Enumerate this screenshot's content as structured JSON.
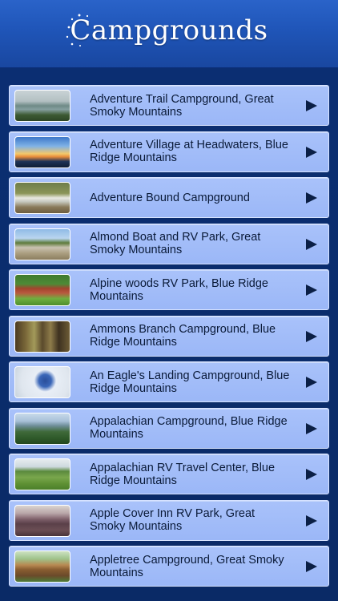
{
  "header": {
    "title": "Campgrounds"
  },
  "list": [
    {
      "name": "Adventure Trail Campground, Great Smoky Mountains",
      "thumb_icon": "lake-mountain-photo"
    },
    {
      "name": "Adventure Village at Headwaters, Blue Ridge Mountains",
      "thumb_icon": "sunset-ridge-photo"
    },
    {
      "name": "Adventure Bound Campground",
      "thumb_icon": "campsite-trailer-photo"
    },
    {
      "name": "Almond Boat and RV Park, Great Smoky Mountains",
      "thumb_icon": "rv-park-photo"
    },
    {
      "name": "Alpine woods RV Park, Blue Ridge Mountains",
      "thumb_icon": "cabin-garden-photo"
    },
    {
      "name": "Ammons Branch Campground, Blue Ridge Mountains",
      "thumb_icon": "forest-campsite-photo"
    },
    {
      "name": "An Eagle's Landing Campground, Blue Ridge Mountains",
      "thumb_icon": "zipline-photo"
    },
    {
      "name": "Appalachian Campground, Blue Ridge Mountains",
      "thumb_icon": "mountain-valley-photo"
    },
    {
      "name": "Appalachian RV Travel Center, Blue Ridge Mountains",
      "thumb_icon": "meadow-photo"
    },
    {
      "name": "Apple Cover Inn RV Park, Great Smoky Mountains",
      "thumb_icon": "smoky-mountains-photo"
    },
    {
      "name": "Appletree Campground, Great Smoky Mountains",
      "thumb_icon": "treehouse-cabin-photo"
    }
  ],
  "row_action_icon": "chevron-right-icon"
}
